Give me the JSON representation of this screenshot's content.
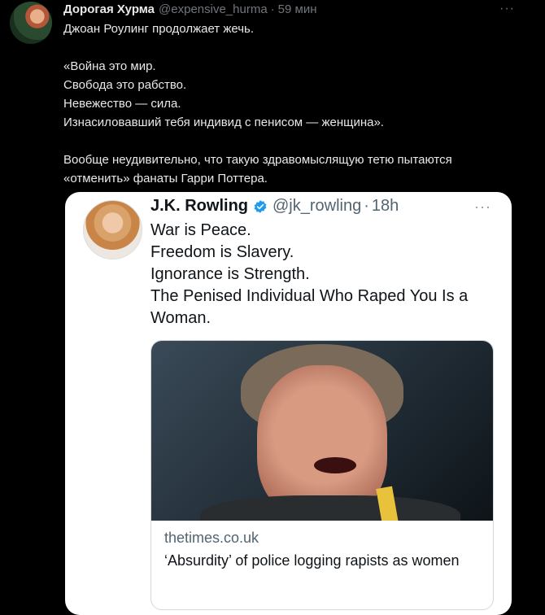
{
  "tweet": {
    "author_name": "Дорогая Хурма",
    "author_handle": "@expensive_hurma",
    "separator": "·",
    "time": "59 мин",
    "more": "···",
    "lines": [
      "Джоан Роулинг продолжает жечь.",
      "",
      "«Война это мир.",
      "Свобода это рабство.",
      "Невежество — сила.",
      "Изнасиловавший тебя индивид с пенисом — женщина».",
      "",
      "Вообще неудивительно, что такую здравомыслящую тетю пытаются",
      "«отменить» фанаты Гарри Поттера."
    ]
  },
  "quoted": {
    "author_name": "J.K. Rowling",
    "author_handle": "@jk_rowling",
    "separator": "·",
    "time": "18h",
    "more": "···",
    "verified_color": "#1d9bf0",
    "lines": [
      "War is Peace.",
      "Freedom is Slavery.",
      "Ignorance is Strength.",
      "The Penised Individual Who Raped You Is a",
      "Woman."
    ],
    "card": {
      "domain": "thetimes.co.uk",
      "title": "‘Absurdity’ of police logging rapists as women"
    }
  },
  "icons": {
    "verified": "verified-badge-icon",
    "more": "more-options-icon"
  }
}
